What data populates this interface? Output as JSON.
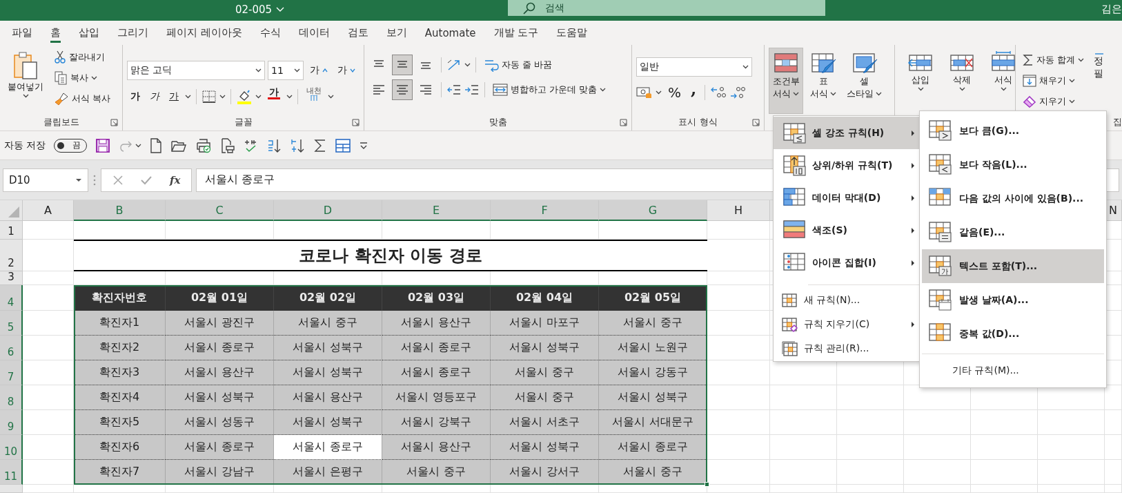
{
  "title_bar": {
    "document": "02-005",
    "search_placeholder": "검색",
    "user": "김은"
  },
  "tabs": [
    {
      "label": "파일",
      "selected": false
    },
    {
      "label": "홈",
      "selected": true
    },
    {
      "label": "삽입",
      "selected": false
    },
    {
      "label": "그리기",
      "selected": false
    },
    {
      "label": "페이지 레이아웃",
      "selected": false
    },
    {
      "label": "수식",
      "selected": false
    },
    {
      "label": "데이터",
      "selected": false
    },
    {
      "label": "검토",
      "selected": false
    },
    {
      "label": "보기",
      "selected": false
    },
    {
      "label": "Automate",
      "selected": false
    },
    {
      "label": "개발 도구",
      "selected": false
    },
    {
      "label": "도움말",
      "selected": false
    }
  ],
  "ribbon": {
    "clipboard": {
      "paste": "붙여넣기",
      "cut": "잘라내기",
      "copy": "복사",
      "format_painter": "서식 복사",
      "label": "클립보드"
    },
    "font": {
      "font_name": "맑은 고딕",
      "font_size": "11",
      "grow": "가",
      "shrink": "가",
      "bold": "가",
      "italic": "가",
      "underline": "가",
      "font_color": "가",
      "phonetic": "내천",
      "label": "글꼴"
    },
    "alignment": {
      "vertical": [
        {
          "kind": "top",
          "selected": false
        },
        {
          "kind": "middle",
          "selected": true
        },
        {
          "kind": "bottom",
          "selected": false
        }
      ],
      "horizontal": [
        {
          "kind": "left",
          "selected": false
        },
        {
          "kind": "center",
          "selected": true
        },
        {
          "kind": "right",
          "selected": false
        }
      ],
      "wrap_text": "자동 줄 바꿈",
      "merge": "병합하고 가운데 맞춤",
      "label": "맞춤"
    },
    "number": {
      "format": "일반",
      "percent": "%",
      "comma": ",",
      "label": "표시 형식"
    },
    "styles": [
      {
        "kind": "conditional",
        "lines": [
          "조건부",
          "서식"
        ],
        "selected": true
      },
      {
        "kind": "table",
        "lines": [
          "표",
          "서식"
        ],
        "selected": false
      },
      {
        "kind": "cell",
        "lines": [
          "셀",
          "스타일"
        ],
        "selected": false
      }
    ],
    "cells": [
      {
        "kind": "insert",
        "label": "삽입"
      },
      {
        "kind": "delete",
        "label": "삭제"
      },
      {
        "kind": "format",
        "label": "서식"
      }
    ],
    "editing": {
      "autosum": "자동 합계",
      "fill": "채우기",
      "clear": "지우기",
      "sort_cut": [
        "정",
        "필"
      ],
      "label": "집"
    }
  },
  "quick_access": {
    "autosave": "자동 저장",
    "toggle": {
      "label": "끔",
      "on": false
    }
  },
  "formula_bar": {
    "name_box": "D10",
    "function": "fx",
    "formula": "서울시 종로구"
  },
  "sheet": {
    "columns": [
      {
        "label": "A",
        "selected": false
      },
      {
        "label": "B",
        "selected": true
      },
      {
        "label": "C",
        "selected": true
      },
      {
        "label": "D",
        "selected": true
      },
      {
        "label": "E",
        "selected": true
      },
      {
        "label": "F",
        "selected": true
      },
      {
        "label": "G",
        "selected": true
      },
      {
        "label": "H",
        "selected": false
      }
    ],
    "last_column": {
      "label": "N",
      "selected": false
    },
    "rows": [
      {
        "label": "1",
        "selected": false
      },
      {
        "label": "2",
        "selected": false
      },
      {
        "label": "3",
        "selected": false
      },
      {
        "label": "4",
        "selected": true
      },
      {
        "label": "5",
        "selected": true
      },
      {
        "label": "6",
        "selected": true
      },
      {
        "label": "7",
        "selected": true
      },
      {
        "label": "8",
        "selected": true
      },
      {
        "label": "9",
        "selected": true
      },
      {
        "label": "10",
        "selected": true
      },
      {
        "label": "11",
        "selected": true
      }
    ],
    "title": "코로나 확진자 이동 경로",
    "table": {
      "header": [
        "확진자번호",
        "02월 01일",
        "02월 02일",
        "02월 03일",
        "02월 04일",
        "02월 05일"
      ],
      "rows": [
        {
          "cells": [
            {
              "text": "확진자1",
              "selected": false
            },
            {
              "text": "서울시 광진구",
              "selected": false
            },
            {
              "text": "서울시 중구",
              "selected": false
            },
            {
              "text": "서울시 용산구",
              "selected": false
            },
            {
              "text": "서울시 마포구",
              "selected": false
            },
            {
              "text": "서울시 중구",
              "selected": false
            }
          ]
        },
        {
          "cells": [
            {
              "text": "확진자2",
              "selected": false
            },
            {
              "text": "서울시 종로구",
              "selected": false
            },
            {
              "text": "서울시 성북구",
              "selected": false
            },
            {
              "text": "서울시 종로구",
              "selected": false
            },
            {
              "text": "서울시 성북구",
              "selected": false
            },
            {
              "text": "서울시 노원구",
              "selected": false
            }
          ]
        },
        {
          "cells": [
            {
              "text": "확진자3",
              "selected": false
            },
            {
              "text": "서울시 용산구",
              "selected": false
            },
            {
              "text": "서울시 성북구",
              "selected": false
            },
            {
              "text": "서울시 종로구",
              "selected": false
            },
            {
              "text": "서울시 중구",
              "selected": false
            },
            {
              "text": "서울시 강동구",
              "selected": false
            }
          ]
        },
        {
          "cells": [
            {
              "text": "확진자4",
              "selected": false
            },
            {
              "text": "서울시 성북구",
              "selected": false
            },
            {
              "text": "서울시 용산구",
              "selected": false
            },
            {
              "text": "서울시 영등포구",
              "selected": false
            },
            {
              "text": "서울시 중구",
              "selected": false
            },
            {
              "text": "서울시 성북구",
              "selected": false
            }
          ]
        },
        {
          "cells": [
            {
              "text": "확진자5",
              "selected": false
            },
            {
              "text": "서울시 성동구",
              "selected": false
            },
            {
              "text": "서울시 성북구",
              "selected": false
            },
            {
              "text": "서울시 강북구",
              "selected": false
            },
            {
              "text": "서울시 서초구",
              "selected": false
            },
            {
              "text": "서울시 서대문구",
              "selected": false
            }
          ]
        },
        {
          "cells": [
            {
              "text": "확진자6",
              "selected": false
            },
            {
              "text": "서울시 종로구",
              "selected": false
            },
            {
              "text": "서울시 종로구",
              "selected": true
            },
            {
              "text": "서울시 용산구",
              "selected": false
            },
            {
              "text": "서울시 성북구",
              "selected": false
            },
            {
              "text": "서울시 종로구",
              "selected": false
            }
          ]
        },
        {
          "cells": [
            {
              "text": "확진자7",
              "selected": false
            },
            {
              "text": "서울시 강남구",
              "selected": false
            },
            {
              "text": "서울시 은평구",
              "selected": false
            },
            {
              "text": "서울시 중구",
              "selected": false
            },
            {
              "text": "서울시 강서구",
              "selected": false
            },
            {
              "text": "서울시 중구",
              "selected": false
            }
          ]
        }
      ]
    }
  },
  "menu": {
    "items": [
      {
        "kind": "highlight-rules",
        "label": "셀 강조 규칙(H)",
        "submenu": true,
        "selected": true
      },
      {
        "kind": "top-bottom",
        "label": "상위/하위 규칙(T)",
        "submenu": true,
        "selected": false
      },
      {
        "kind": "data-bars",
        "label": "데이터 막대(D)",
        "submenu": true,
        "selected": false
      },
      {
        "kind": "color-scales",
        "label": "색조(S)",
        "submenu": true,
        "selected": false
      },
      {
        "kind": "icon-sets",
        "label": "아이콘 집합(I)",
        "submenu": true,
        "selected": false
      },
      {
        "kind": "new-rule",
        "label": "새 규칙(N)...",
        "submenu": false,
        "selected": false
      },
      {
        "kind": "clear-rules",
        "label": "규칙 지우기(C)",
        "submenu": true,
        "selected": false
      },
      {
        "kind": "manage-rules",
        "label": "규칙 관리(R)...",
        "submenu": false,
        "selected": false
      }
    ]
  },
  "submenu": {
    "items": [
      {
        "kind": "greater",
        "label": "보다 큼(G)...",
        "selected": false
      },
      {
        "kind": "less",
        "label": "보다 작음(L)...",
        "selected": false
      },
      {
        "kind": "between",
        "label": "다음 값의 사이에 있음(B)...",
        "selected": false
      },
      {
        "kind": "equal",
        "label": "같음(E)...",
        "selected": false
      },
      {
        "kind": "text",
        "label": "텍스트 포함(T)...",
        "selected": true
      },
      {
        "kind": "date",
        "label": "발생 날짜(A)...",
        "selected": false
      },
      {
        "kind": "duplicate",
        "label": "중복 값(D)...",
        "selected": false
      },
      {
        "kind": "more",
        "label": "기타 규칙(M)...",
        "selected": false
      }
    ]
  }
}
